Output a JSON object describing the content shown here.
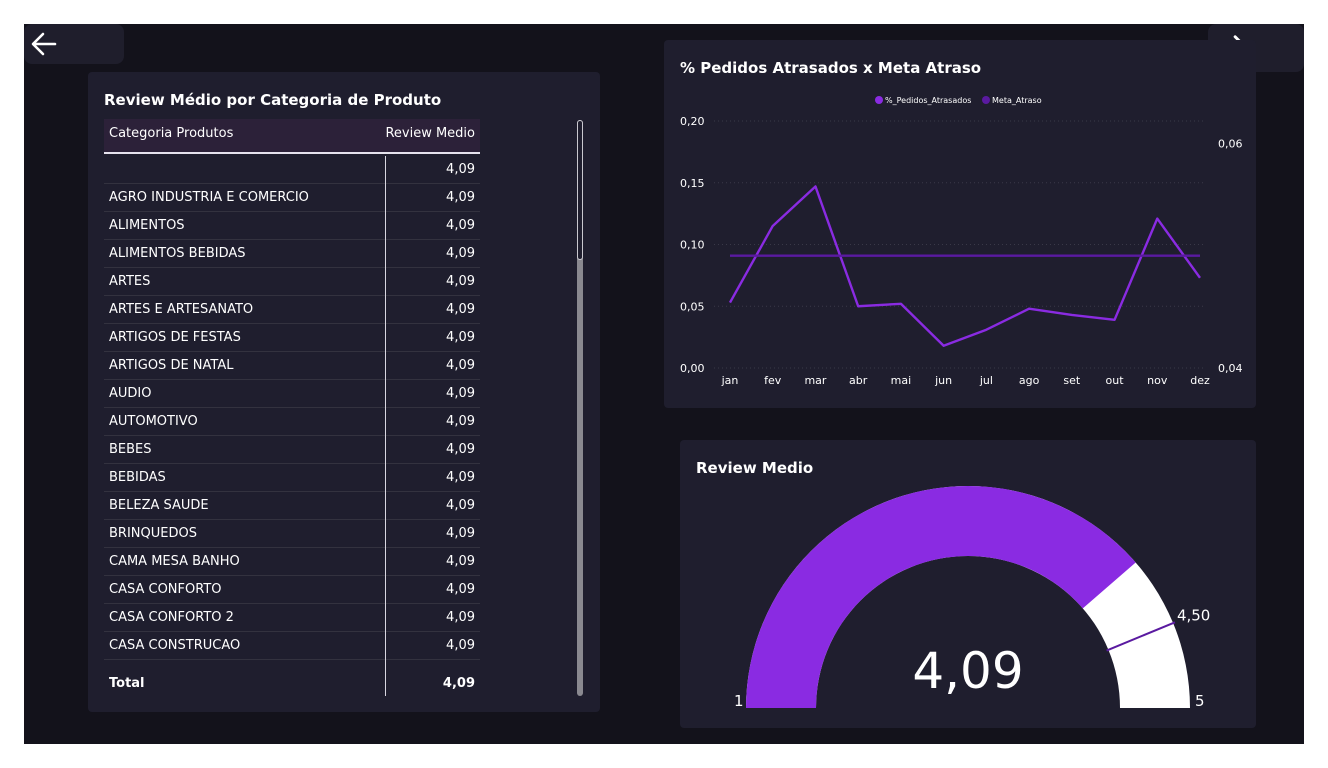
{
  "nav": {
    "back_icon": "arrow-left-icon",
    "forward_icon": "arrow-right-icon"
  },
  "table_panel": {
    "title": "Review Médio por Categoria de Produto",
    "columns": [
      "Categoria Produtos",
      "Review Medio"
    ],
    "rows": [
      {
        "category": "",
        "value": "4,09"
      },
      {
        "category": "AGRO INDUSTRIA E COMERCIO",
        "value": "4,09"
      },
      {
        "category": "ALIMENTOS",
        "value": "4,09"
      },
      {
        "category": "ALIMENTOS BEBIDAS",
        "value": "4,09"
      },
      {
        "category": "ARTES",
        "value": "4,09"
      },
      {
        "category": "ARTES E ARTESANATO",
        "value": "4,09"
      },
      {
        "category": "ARTIGOS DE FESTAS",
        "value": "4,09"
      },
      {
        "category": "ARTIGOS DE NATAL",
        "value": "4,09"
      },
      {
        "category": "AUDIO",
        "value": "4,09"
      },
      {
        "category": "AUTOMOTIVO",
        "value": "4,09"
      },
      {
        "category": "BEBES",
        "value": "4,09"
      },
      {
        "category": "BEBIDAS",
        "value": "4,09"
      },
      {
        "category": "BELEZA SAUDE",
        "value": "4,09"
      },
      {
        "category": "BRINQUEDOS",
        "value": "4,09"
      },
      {
        "category": "CAMA MESA BANHO",
        "value": "4,09"
      },
      {
        "category": "CASA CONFORTO",
        "value": "4,09"
      },
      {
        "category": "CASA CONFORTO 2",
        "value": "4,09"
      },
      {
        "category": "CASA CONSTRUCAO",
        "value": "4,09"
      }
    ],
    "total_label": "Total",
    "total_value": "4,09"
  },
  "chart_data": [
    {
      "type": "line",
      "title": "% Pedidos Atrasados x Meta Atraso",
      "categories": [
        "jan",
        "fev",
        "mar",
        "abr",
        "mai",
        "jun",
        "jul",
        "ago",
        "set",
        "out",
        "nov",
        "dez"
      ],
      "series": [
        {
          "name": "%_Pedidos_Atrasados",
          "axis": "left",
          "color": "#8a2be2",
          "values": [
            0.053,
            0.115,
            0.147,
            0.05,
            0.052,
            0.018,
            0.031,
            0.048,
            0.043,
            0.039,
            0.121,
            0.073
          ]
        },
        {
          "name": "Meta_Atraso",
          "axis": "right",
          "color": "#5a1aa0",
          "values": [
            0.05,
            0.05,
            0.05,
            0.05,
            0.05,
            0.05,
            0.05,
            0.05,
            0.05,
            0.05,
            0.05,
            0.05
          ]
        }
      ],
      "y_left": {
        "ylim": [
          0,
          0.2
        ],
        "ticks": [
          "0,00",
          "0,05",
          "0,10",
          "0,15",
          "0,20"
        ]
      },
      "y_right": {
        "ylim": [
          0.04,
          0.062
        ],
        "ticks": [
          "0,04",
          "0,06"
        ]
      },
      "legend": "top-center",
      "grid": true
    },
    {
      "type": "gauge",
      "title": "Review Medio",
      "value": 4.09,
      "value_label": "4,09",
      "min": 1,
      "min_label": "1",
      "max": 5,
      "max_label": "5",
      "target": 4.5,
      "target_label": "4,50",
      "fill_color": "#8a2be2",
      "track_color": "#ffffff",
      "target_color": "#5a1aa0"
    }
  ]
}
